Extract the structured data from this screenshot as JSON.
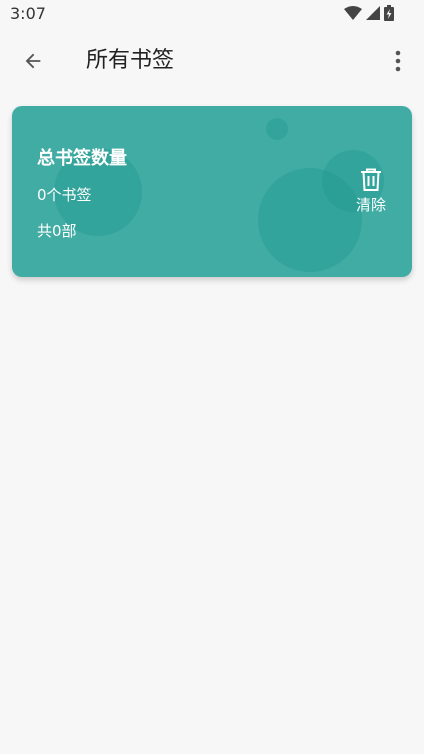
{
  "status_bar": {
    "time": "3:07",
    "icons": [
      "wifi-icon",
      "cellular-signal-icon",
      "battery-charging-icon"
    ]
  },
  "app_bar": {
    "title": "所有书签",
    "back_icon": "arrow-left-icon",
    "menu_icon": "more-vert-icon"
  },
  "summary_card": {
    "title": "总书签数量",
    "bookmark_count_text": "0个书签",
    "book_count_text": "共0部",
    "clear_label": "清除",
    "clear_icon": "trash-icon",
    "background_color": "#40aca4"
  }
}
